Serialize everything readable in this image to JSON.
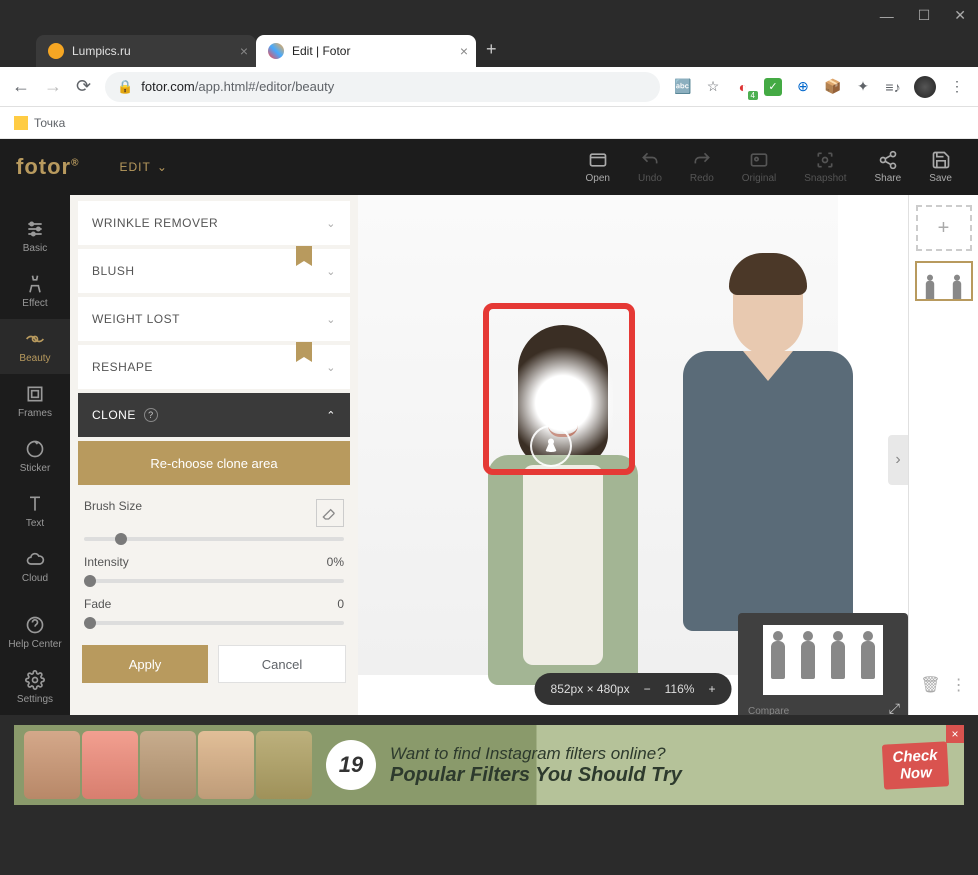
{
  "window": {
    "min": "—",
    "max": "☐",
    "close": "✕"
  },
  "tabs": [
    {
      "title": "Lumpics.ru",
      "favicon": "#f5a623",
      "active": false
    },
    {
      "title": "Edit | Fotor",
      "favicon": "multicolor",
      "active": true
    }
  ],
  "address": {
    "lock": "🔒",
    "url_host": "fotor.com",
    "url_path": "/app.html#/editor/beauty",
    "translate": "🌐",
    "star": "☆"
  },
  "extensions": {
    "adblock_badge": "4"
  },
  "bookmark": {
    "label": "Точка"
  },
  "header": {
    "logo": "fotor",
    "edit_label": "EDIT",
    "tools": {
      "open": "Open",
      "undo": "Undo",
      "redo": "Redo",
      "original": "Original",
      "snapshot": "Snapshot",
      "share": "Share",
      "save": "Save"
    }
  },
  "left_toolbar": {
    "basic": "Basic",
    "effect": "Effect",
    "beauty": "Beauty",
    "frames": "Frames",
    "sticker": "Sticker",
    "text": "Text",
    "cloud": "Cloud",
    "help": "Help Center",
    "settings": "Settings"
  },
  "panel": {
    "wrinkle": "WRINKLE REMOVER",
    "blush": "BLUSH",
    "weight": "WEIGHT LOST",
    "reshape": "RESHAPE",
    "clone": "CLONE",
    "rechoose": "Re-choose clone area",
    "brush_label": "Brush Size",
    "intensity_label": "Intensity",
    "intensity_value": "0%",
    "fade_label": "Fade",
    "fade_value": "0",
    "apply": "Apply",
    "cancel": "Cancel"
  },
  "canvas": {
    "dimensions": "852px × 480px",
    "zoom": "116%",
    "compare": "Compare"
  },
  "ad": {
    "number": "19",
    "line1": "Want to find Instagram filters online?",
    "line2": "Popular Filters You Should Try",
    "cta1": "Check",
    "cta2": "Now"
  }
}
